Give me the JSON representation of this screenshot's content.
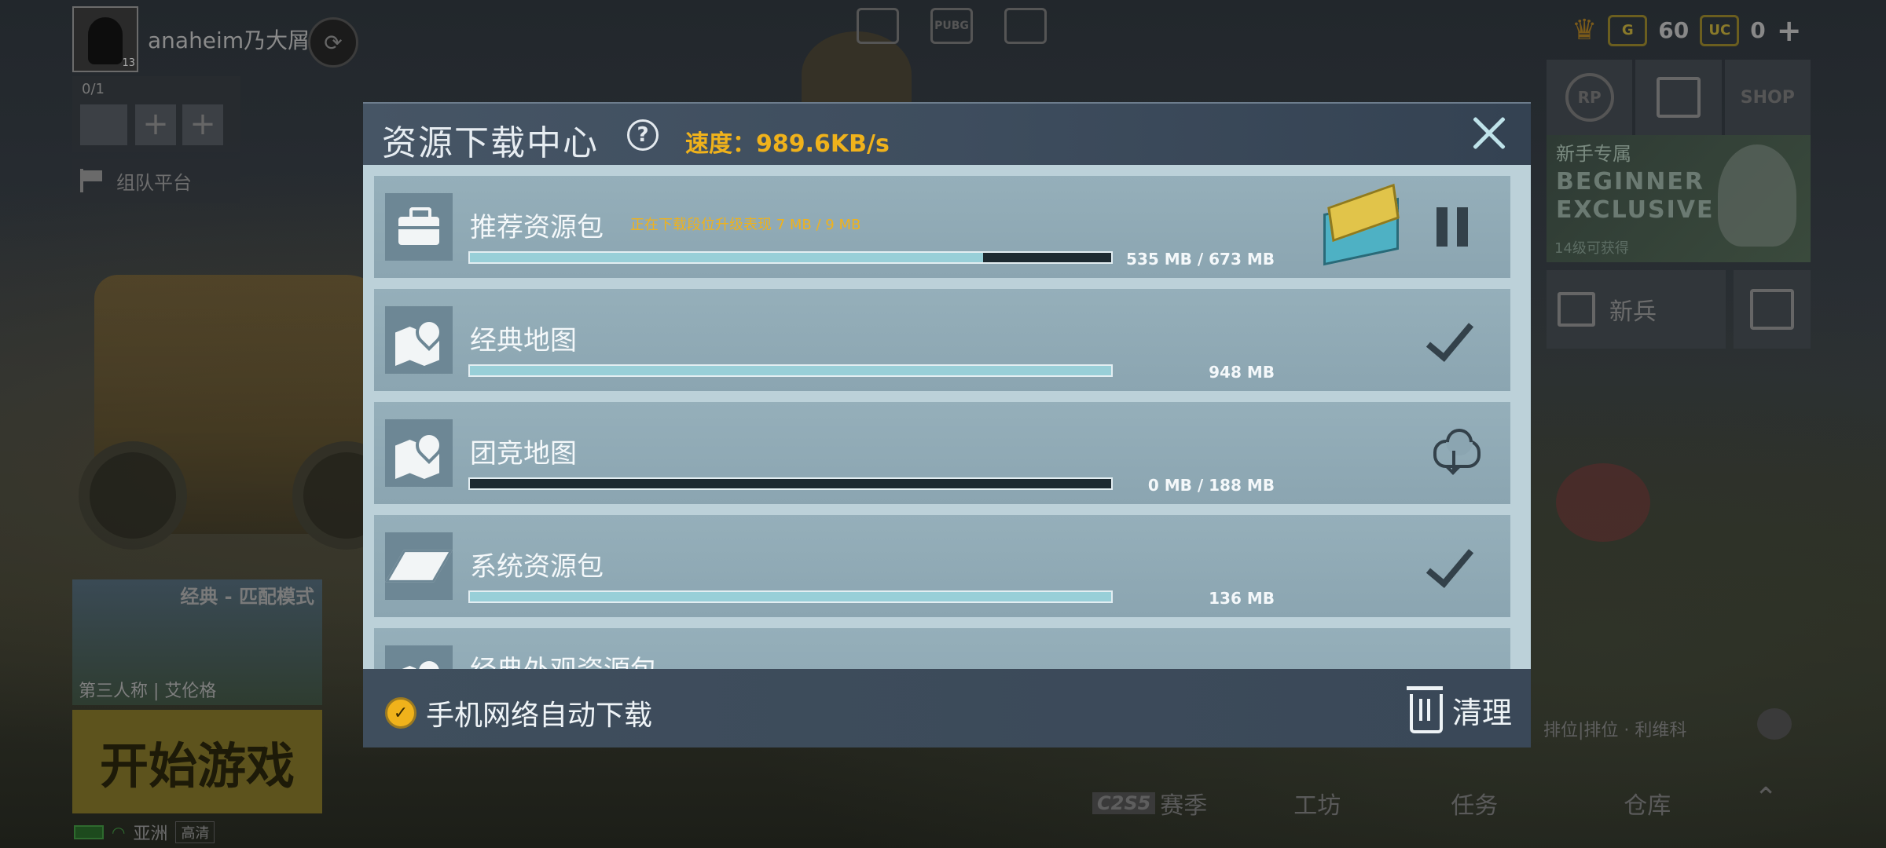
{
  "lobby": {
    "username": "anaheim乃大屑",
    "avatar_level": "13",
    "team": {
      "count": "0/1",
      "slot_plus": "+",
      "platform": "组队平台"
    },
    "top_center_icons": [
      "wardrobe-icon",
      "pubg-mobile-logo",
      "bag-icon"
    ],
    "top_center_logo": "PUBG",
    "currency": [
      {
        "icon": "G",
        "value": "60"
      },
      {
        "icon": "UC",
        "value": "0"
      }
    ],
    "plus": "+",
    "right_panels": {
      "rp": "RP",
      "shop": "SHOP"
    },
    "beginner": {
      "title": "新手专属",
      "line1": "BEGINNER",
      "line2": "EXCLUSIVE",
      "sub": "14级可获得"
    },
    "rookie_label": "新兵",
    "mode": {
      "title": "经典 - 匹配模式",
      "sub": "第三人称 | 艾伦格"
    },
    "start_label": "开始游戏",
    "status": {
      "region": "亚洲",
      "quality": "高清"
    },
    "rank_text": "排位|排位 · 利维科",
    "bottom_nav": {
      "season_badge": "C2S5",
      "season": "赛季",
      "workshop": "工坊",
      "mission": "任务",
      "inventory": "仓库",
      "up": "⌃"
    }
  },
  "modal": {
    "title": "资源下载中心",
    "help": "?",
    "speed": "速度：989.6KB/s",
    "items": [
      {
        "title": "推荐资源包",
        "status_text": "正在下载段位升级表现 7 MB / 9 MB",
        "size": "535 MB / 673 MB",
        "progress": 0.8,
        "icon": "suitcase-icon",
        "state": "pause-icon"
      },
      {
        "title": "经典地图",
        "status_text": "",
        "size": "948 MB",
        "progress": 1.0,
        "icon": "map-icon",
        "state": "check-icon"
      },
      {
        "title": "团竞地图",
        "status_text": "",
        "size": "0 MB / 188 MB",
        "progress": 0.0,
        "icon": "map-icon",
        "state": "cloud-download-icon"
      },
      {
        "title": "系统资源包",
        "status_text": "",
        "size": "136 MB",
        "progress": 1.0,
        "icon": "cube-icon",
        "state": "check-icon"
      },
      {
        "title": "经典外观资源包",
        "status_text": "",
        "size": "",
        "progress": 0.0,
        "icon": "map-icon",
        "state": ""
      }
    ],
    "footer": {
      "auto_download": "手机网络自动下载",
      "auto_checked": "✓",
      "clean": "清理"
    }
  },
  "colors": {
    "accent": "#f0b21b",
    "item_bg": "#8ba5b1",
    "progress": "#98cfd8"
  }
}
